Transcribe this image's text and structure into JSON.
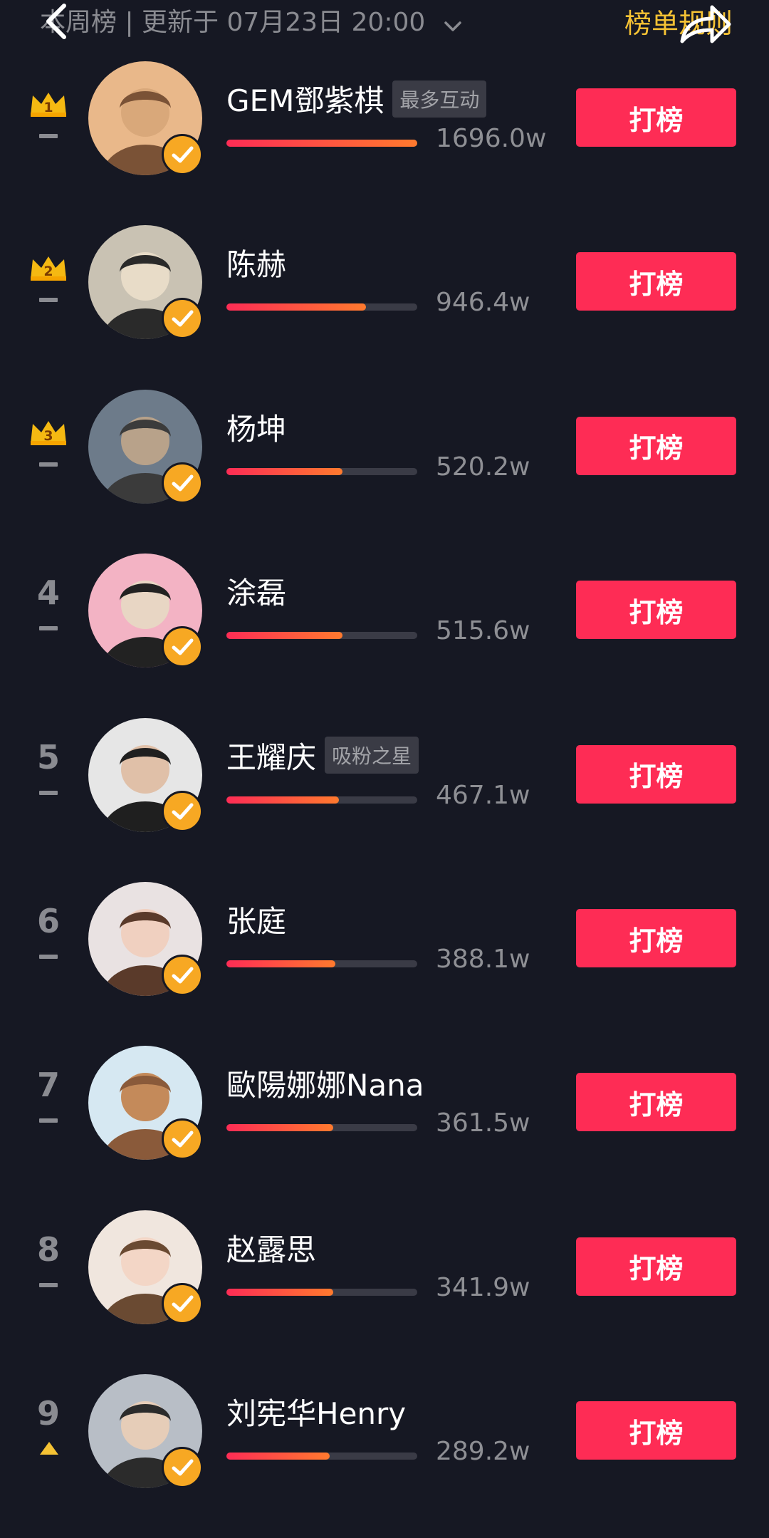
{
  "header": {
    "title": "本周榜 | 更新于 07月23日 20:00",
    "rules_link": "榜单规则"
  },
  "colors": {
    "background": "#161823",
    "accent_red": "#fe2c55",
    "gold": "#f5c234",
    "verify_orange": "#f7a823"
  },
  "vote_label": "打榜",
  "icons": [
    "back-arrow-icon",
    "chevron-down-icon",
    "share-arrow-icon",
    "crown-icon",
    "verified-check-icon",
    "trend-flat-icon",
    "trend-up-icon"
  ],
  "rows": [
    {
      "rank": "1",
      "name": "GEM鄧紫棋",
      "badge": "最多互动",
      "score": "1696.0w",
      "progress": 1.0,
      "trend": "flat"
    },
    {
      "rank": "2",
      "name": "陈赫",
      "badge": "",
      "score": "946.4w",
      "progress": 0.73,
      "trend": "flat"
    },
    {
      "rank": "3",
      "name": "杨坤",
      "badge": "",
      "score": "520.2w",
      "progress": 0.61,
      "trend": "flat"
    },
    {
      "rank": "4",
      "name": "涂磊",
      "badge": "",
      "score": "515.6w",
      "progress": 0.61,
      "trend": "flat"
    },
    {
      "rank": "5",
      "name": "王耀庆",
      "badge": "吸粉之星",
      "score": "467.1w",
      "progress": 0.59,
      "trend": "flat"
    },
    {
      "rank": "6",
      "name": "张庭",
      "badge": "",
      "score": "388.1w",
      "progress": 0.57,
      "trend": "flat"
    },
    {
      "rank": "7",
      "name": "歐陽娜娜Nana",
      "badge": "",
      "score": "361.5w",
      "progress": 0.56,
      "trend": "flat"
    },
    {
      "rank": "8",
      "name": "赵露思",
      "badge": "",
      "score": "341.9w",
      "progress": 0.56,
      "trend": "flat"
    },
    {
      "rank": "9",
      "name": "刘宪华Henry",
      "badge": "",
      "score": "289.2w",
      "progress": 0.54,
      "trend": "up"
    }
  ]
}
